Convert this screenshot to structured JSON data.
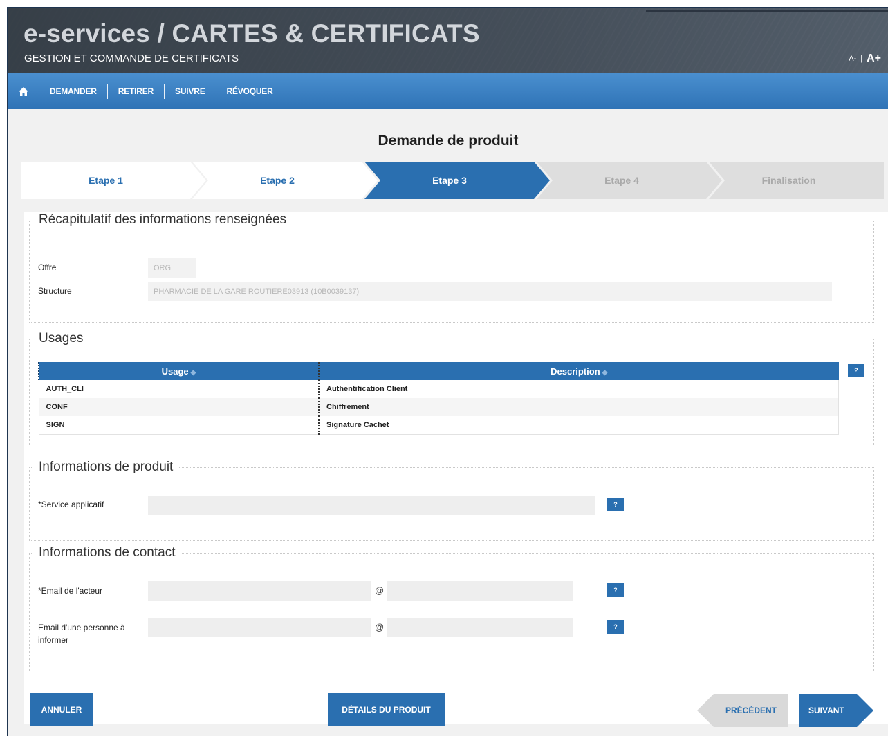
{
  "header": {
    "title": "e-services / CARTES & CERTIFICATS",
    "subtitle": "GESTION ET COMMANDE DE CERTIFICATS",
    "font_decrease": "A-",
    "font_divider": "|",
    "font_increase": "A+"
  },
  "nav": {
    "home_icon": "home-icon",
    "items": [
      "DEMANDER",
      "RETIRER",
      "SUIVRE",
      "RÉVOQUER"
    ]
  },
  "page": {
    "title": "Demande de produit"
  },
  "steps": [
    {
      "label": "Etape 1",
      "state": "done"
    },
    {
      "label": "Etape 2",
      "state": "done"
    },
    {
      "label": "Etape 3",
      "state": "active"
    },
    {
      "label": "Etape 4",
      "state": "todo"
    },
    {
      "label": "Finalisation",
      "state": "todo"
    }
  ],
  "recap": {
    "legend": "Récapitulatif des informations renseignées",
    "offer_label": "Offre",
    "offer_value": "ORG",
    "structure_label": "Structure",
    "structure_value": "PHARMACIE DE LA GARE ROUTIERE03913 (10B0039137)"
  },
  "usages": {
    "legend": "Usages",
    "columns": [
      "Usage",
      "Description"
    ],
    "sort_icon": "◆",
    "help": "?",
    "rows": [
      {
        "usage": "AUTH_CLI",
        "description": "Authentification Client"
      },
      {
        "usage": "CONF",
        "description": "Chiffrement"
      },
      {
        "usage": "SIGN",
        "description": "Signature Cachet"
      }
    ]
  },
  "product": {
    "legend": "Informations de produit",
    "service_label": "*Service applicatif",
    "service_value": "",
    "help": "?"
  },
  "contact": {
    "legend": "Informations de contact",
    "actor_email_label": "*Email de l'acteur",
    "inform_email_label": "Email d'une personne à informer",
    "at_sign": "@",
    "help": "?"
  },
  "buttons": {
    "cancel": "ANNULER",
    "details": "DÉTAILS DU PRODUIT",
    "previous": "PRÉCÉDENT",
    "next": "SUIVANT"
  },
  "colors": {
    "primary": "#2a6fb0",
    "header_bg": "#525d69",
    "step_inactive": "#dedede"
  }
}
